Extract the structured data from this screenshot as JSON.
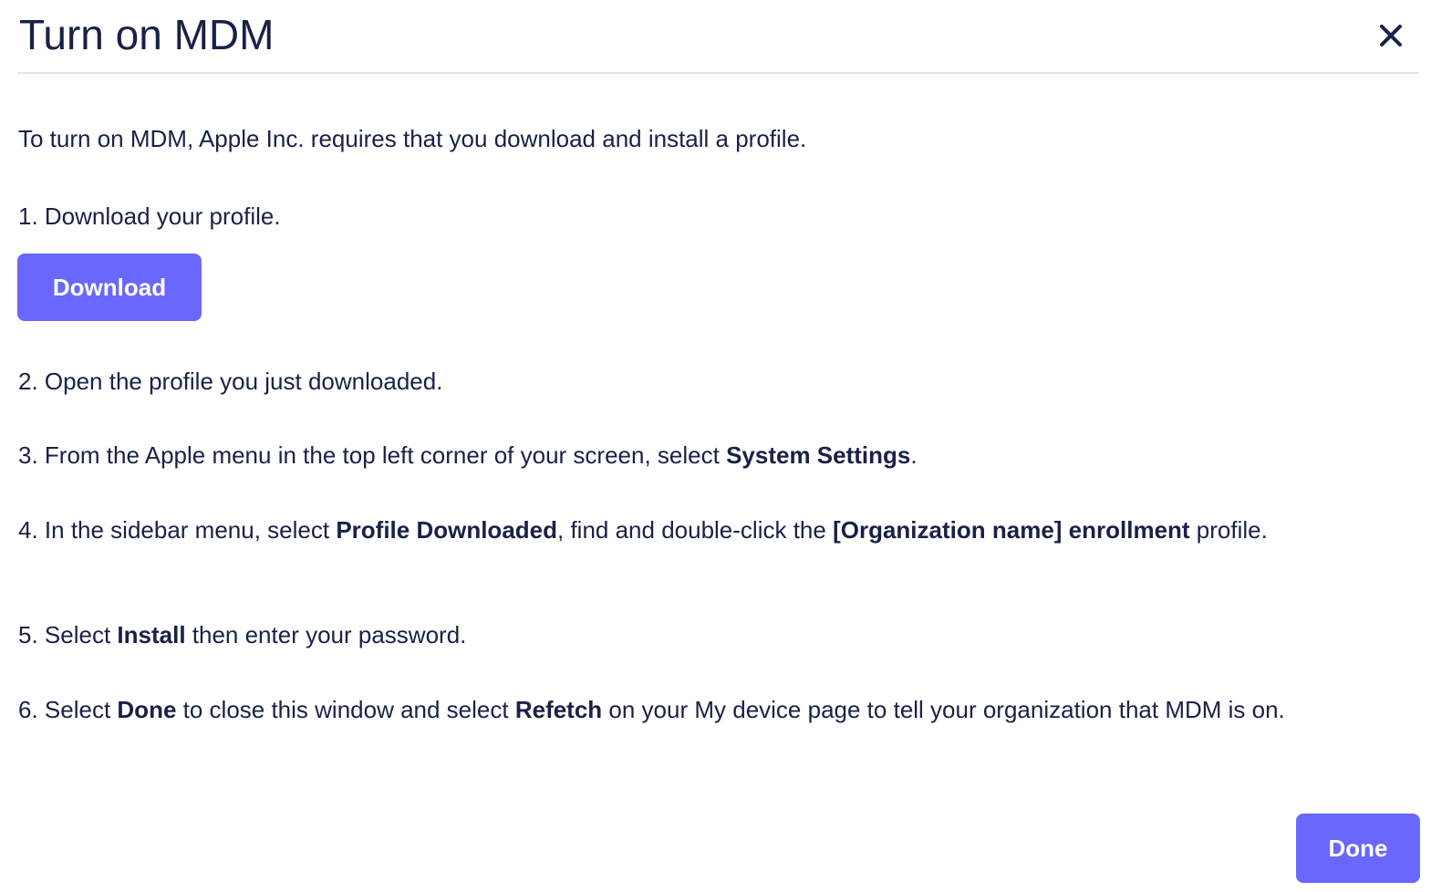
{
  "modal": {
    "title": "Turn on MDM",
    "close_icon": "close-icon"
  },
  "intro": "To turn on MDM, Apple Inc. requires that you download and install a profile.",
  "steps": {
    "s1": "1. Download your profile.",
    "download_label": "Download",
    "s2": "2. Open the profile you just downloaded.",
    "s3_pre": "3. From the Apple menu in the top left corner of your screen, select ",
    "s3_bold": "System Settings",
    "s3_post": ".",
    "s4_pre": "4. In the sidebar menu, select ",
    "s4_bold1": "Profile Downloaded",
    "s4_mid": ", find and double-click the ",
    "s4_bold2": "[Organization name] enrollment",
    "s4_post": " profile.",
    "s5_pre": "5. Select ",
    "s5_bold": "Install",
    "s5_post": " then enter your password.",
    "s6_pre": "6. Select ",
    "s6_bold1": "Done",
    "s6_mid": " to close this window and select ",
    "s6_bold2": "Refetch",
    "s6_post": " on your My device page to tell your organization that MDM is on."
  },
  "footer": {
    "done_label": "Done"
  },
  "colors": {
    "primary": "#6a67fe",
    "text": "#192147",
    "divider": "#e2e4ea"
  }
}
